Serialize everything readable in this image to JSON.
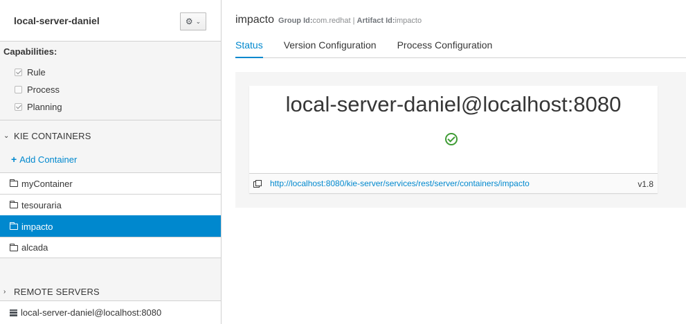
{
  "sidebar": {
    "server_name": "local-server-daniel",
    "capabilities": {
      "title": "Capabilities:",
      "items": [
        {
          "label": "Rule",
          "checked": true
        },
        {
          "label": "Process",
          "checked": false
        },
        {
          "label": "Planning",
          "checked": true
        }
      ]
    },
    "kie_containers": {
      "title": "KIE CONTAINERS",
      "add_label": "Add Container",
      "items": [
        {
          "label": "myContainer"
        },
        {
          "label": "tesouraria"
        },
        {
          "label": "impacto",
          "active": true
        },
        {
          "label": "alcada"
        }
      ]
    },
    "remote_servers": {
      "title": "REMOTE SERVERS",
      "items": [
        {
          "label": "local-server-daniel@localhost:8080"
        }
      ]
    }
  },
  "main": {
    "container_name": "impacto",
    "group_id_label": "Group Id:",
    "group_id": "com.redhat",
    "separator": "|",
    "artifact_id_label": "Artifact Id:",
    "artifact_id": "impacto",
    "tabs": [
      {
        "label": "Status",
        "active": true
      },
      {
        "label": "Version Configuration"
      },
      {
        "label": "Process Configuration"
      }
    ],
    "status_card": {
      "title": "local-server-daniel@localhost:8080",
      "status_icon": "ok-circle-icon",
      "url": "http://localhost:8080/kie-server/services/rest/server/containers/impacto",
      "version": "v1.8"
    }
  },
  "colors": {
    "accent": "#0088ce",
    "success": "#3f9c35"
  }
}
